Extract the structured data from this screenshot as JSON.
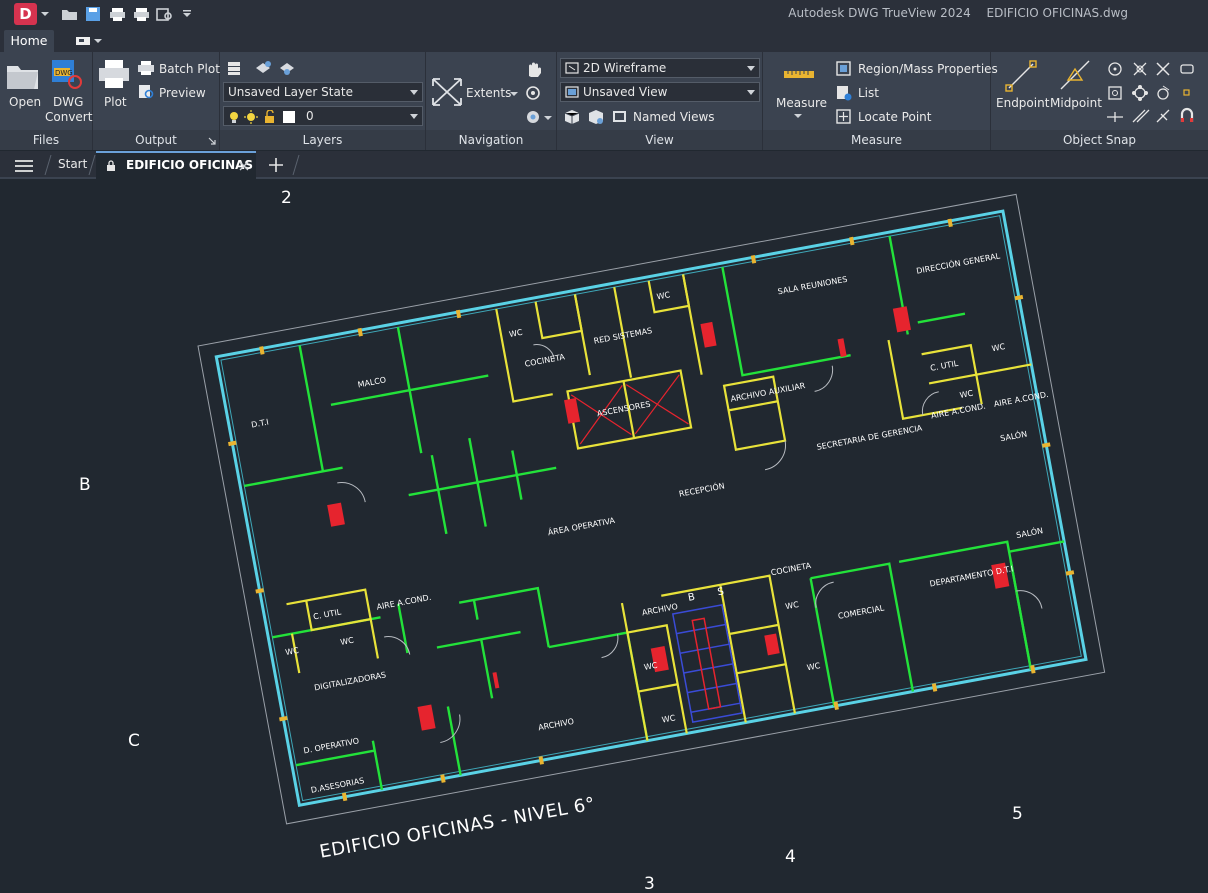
{
  "window": {
    "app_name": "Autodesk DWG TrueView 2024",
    "file_name": "EDIFICIO OFICINAS.dwg",
    "logo_letter": "D"
  },
  "quick_access": [
    "open-icon",
    "save-icon",
    "plot-icon",
    "batch-plot-icon",
    "preview-icon",
    "more-icon"
  ],
  "ribbon_tabs": {
    "home": "Home"
  },
  "ribbon": {
    "files": {
      "title": "Files",
      "open": "Open",
      "dwg_convert_line1": "DWG",
      "dwg_convert_line2": "Convert"
    },
    "output": {
      "title": "Output",
      "plot": "Plot",
      "batch_plot": "Batch Plot",
      "preview": "Preview"
    },
    "layers": {
      "title": "Layers",
      "layer_state": "Unsaved Layer State",
      "current_layer": "0"
    },
    "navigation": {
      "title": "Navigation",
      "extents": "Extents"
    },
    "view": {
      "title": "View",
      "visual_style": "2D Wireframe",
      "saved_view": "Unsaved View",
      "named_views": "Named Views"
    },
    "measure": {
      "title": "Measure",
      "measure": "Measure",
      "region_mass": "Region/Mass Properties",
      "list": "List",
      "locate_point": "Locate Point"
    },
    "object_snap": {
      "title": "Object Snap",
      "endpoint": "Endpoint",
      "midpoint": "Midpoint"
    }
  },
  "doc_tabs": {
    "start": "Start",
    "active": "EDIFICIO OFICINAS"
  },
  "drawing": {
    "sheet_title": "EDIFICIO OFICINAS - NIVEL 6°",
    "grid_bubbles": [
      "2",
      "3",
      "4",
      "5",
      "B",
      "C"
    ],
    "rooms": [
      "D.T.I",
      "MALCO",
      "WC",
      "COCINETA",
      "RED SISTEMAS",
      "WC",
      "SALA REUNIONES",
      "DIRECCIÓN GENERAL",
      "ASCENSORES",
      "ARCHIVO AUXILIAR",
      "C. UTIL",
      "WC",
      "WC",
      "AIRE A.COND.",
      "AIRE A.COND.",
      "SECRETARIA DE GERENCIA",
      "SALÓN",
      "RECEPCIÓN",
      "ÁREA OPERATIVA",
      "C. UTIL",
      "AIRE A.COND.",
      "WC",
      "WC",
      "DIGITALIZADORAS",
      "D. OPERATIVO",
      "ARCHIVO",
      "ARCHIVO",
      "B",
      "S",
      "COCINETA",
      "WC",
      "WC",
      "WC",
      "WC",
      "COMERCIAL",
      "DEPARTAMENTO D.T.I",
      "SALÓN",
      "D.ASESORIAS"
    ]
  },
  "colors": {
    "accent": "#6aa0d8",
    "wall_green": "#23e23a",
    "wall_yellow": "#e8e23a",
    "wall_cyan": "#5ad2e6",
    "red": "#e6242e"
  }
}
